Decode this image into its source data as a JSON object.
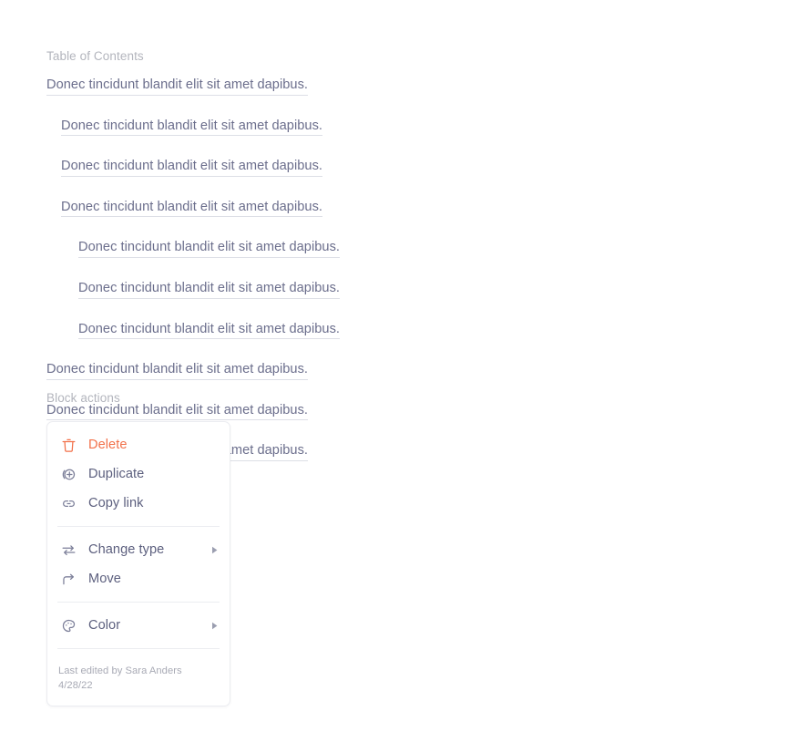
{
  "toc": {
    "label": "Table of Contents",
    "items": [
      {
        "text": "Donec tincidunt blandit elit sit amet dapibus.",
        "level": 1
      },
      {
        "text": "Donec tincidunt blandit elit sit amet dapibus.",
        "level": 2
      },
      {
        "text": "Donec tincidunt blandit elit sit amet dapibus.",
        "level": 2
      },
      {
        "text": "Donec tincidunt blandit elit sit amet dapibus.",
        "level": 2
      },
      {
        "text": "Donec tincidunt blandit elit sit amet dapibus.",
        "level": 3
      },
      {
        "text": "Donec tincidunt blandit elit sit amet dapibus.",
        "level": 3
      },
      {
        "text": "Donec tincidunt blandit elit sit amet dapibus.",
        "level": 3
      },
      {
        "text": "Donec tincidunt blandit elit sit amet dapibus.",
        "level": 1
      },
      {
        "text": "Donec tincidunt blandit elit sit amet dapibus.",
        "level": 1
      },
      {
        "text": "Donec tincidunt blandit elit sit amet dapibus.",
        "level": 1
      }
    ]
  },
  "block_actions": {
    "label": "Block actions",
    "groups": [
      {
        "items": [
          {
            "label": "Delete",
            "icon": "trash-icon",
            "danger": true,
            "submenu": false
          },
          {
            "label": "Duplicate",
            "icon": "duplicate-icon",
            "danger": false,
            "submenu": false
          },
          {
            "label": "Copy link",
            "icon": "link-icon",
            "danger": false,
            "submenu": false
          }
        ]
      },
      {
        "items": [
          {
            "label": "Change type",
            "icon": "swap-arrows-icon",
            "danger": false,
            "submenu": true
          },
          {
            "label": "Move",
            "icon": "arrow-turn-right-icon",
            "danger": false,
            "submenu": false
          }
        ]
      },
      {
        "items": [
          {
            "label": "Color",
            "icon": "palette-icon",
            "danger": false,
            "submenu": true
          }
        ]
      }
    ],
    "footer": {
      "edited_by": "Last edited by Sara Anders",
      "edited_date": "4/28/22"
    }
  },
  "colors": {
    "danger": "#f2714a",
    "text": "#5c5f7e",
    "link": "#6b6e8c",
    "muted": "#b3b5bd",
    "border": "#ebecf0",
    "background": "#ffffff"
  }
}
